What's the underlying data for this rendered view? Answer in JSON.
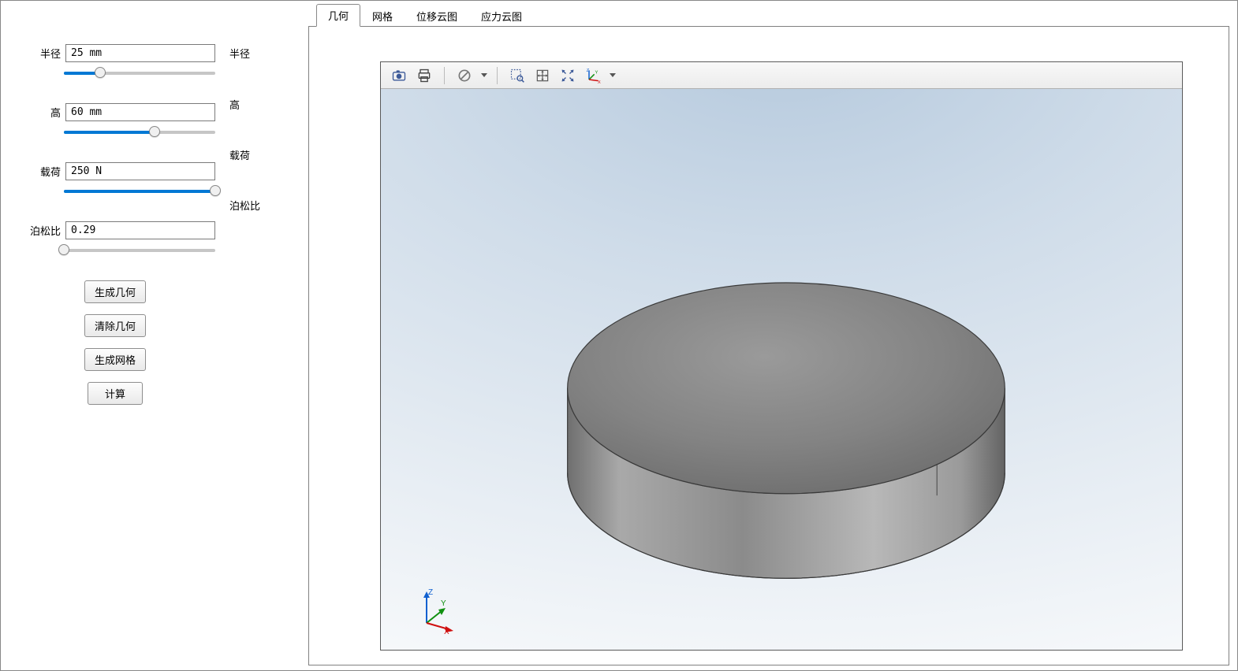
{
  "params": {
    "radius": {
      "label": "半径",
      "value": "25 mm",
      "right_label": "半径",
      "fill_pct": 24,
      "thumb_pct": 24
    },
    "height": {
      "label": "高",
      "value": "60 mm",
      "right_label": "高",
      "fill_pct": 60,
      "thumb_pct": 60
    },
    "load": {
      "label": "载荷",
      "value": "250 N",
      "right_label": "载荷",
      "fill_pct": 100,
      "thumb_pct": 100
    },
    "poisson": {
      "label": "泊松比",
      "value": "0.29",
      "right_label": "泊松比",
      "fill_pct": 0,
      "thumb_pct": 0
    }
  },
  "buttons": {
    "gen_geom": "生成几何",
    "clear_geom": "清除几何",
    "gen_mesh": "生成网格",
    "compute": "计算"
  },
  "tabs": {
    "geometry": "几何",
    "mesh": "网格",
    "disp_cloud": "位移云图",
    "stress_cloud": "应力云图",
    "active": "geometry"
  },
  "toolbar_icons": {
    "camera": "camera-icon",
    "print": "print-icon",
    "disable": "disable-icon",
    "zoom_box": "zoom-box-icon",
    "pan": "pan-icon",
    "fit": "fit-view-icon",
    "axes": "axes-icon"
  },
  "triad": {
    "x": "X",
    "y": "Y",
    "z": "Z"
  }
}
